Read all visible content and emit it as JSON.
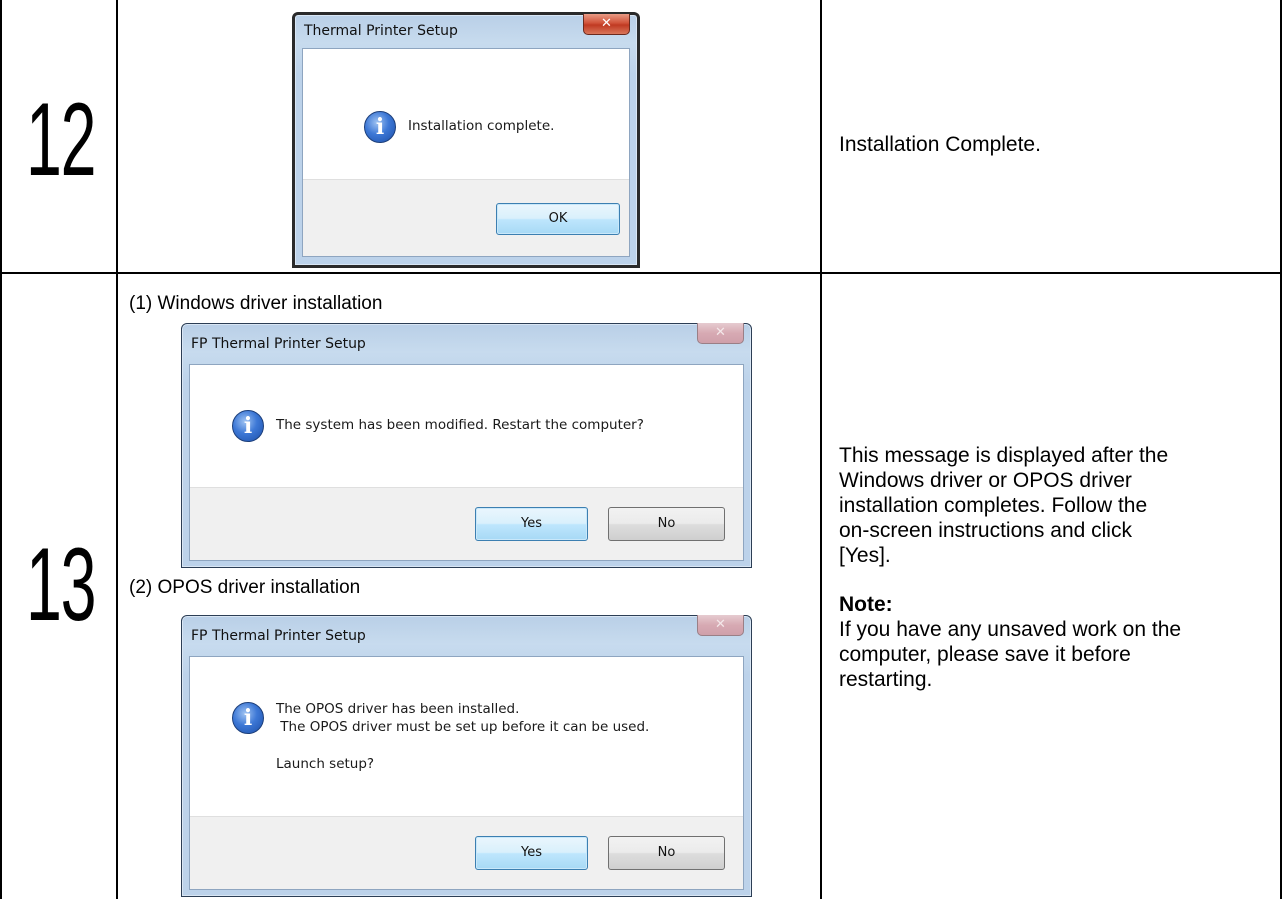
{
  "steps": [
    {
      "number": "12",
      "dialog": {
        "title": "Thermal Printer Setup",
        "close_glyph": "✕",
        "icon": "info-icon",
        "message": "Installation complete.",
        "ok_label": "OK"
      },
      "description": "Installation Complete."
    },
    {
      "number": "13",
      "caption_windows": "(1) Windows driver installation",
      "dialog_windows": {
        "title": "FP Thermal Printer Setup",
        "close_glyph": "✕",
        "icon": "info-icon",
        "message": "The system has been modified. Restart the computer?",
        "yes_label": "Yes",
        "no_label": "No"
      },
      "caption_opos": "(2) OPOS driver installation",
      "dialog_opos": {
        "title": "FP Thermal Printer Setup",
        "close_glyph": "✕",
        "icon": "info-icon",
        "message_line1": "The OPOS driver has been installed.",
        "message_line2": " The OPOS driver must be set up before it can be used.",
        "message_line3": "Launch setup?",
        "yes_label": "Yes",
        "no_label": "No"
      },
      "description_lines": [
        "This message is displayed after the",
        "Windows driver or OPOS driver",
        "installation completes. Follow the",
        "on-screen instructions and click",
        "[Yes]."
      ],
      "note_heading": "Note:",
      "note_lines": [
        "If you have any unsaved work on the",
        "computer, please save it before",
        "restarting."
      ]
    }
  ]
}
